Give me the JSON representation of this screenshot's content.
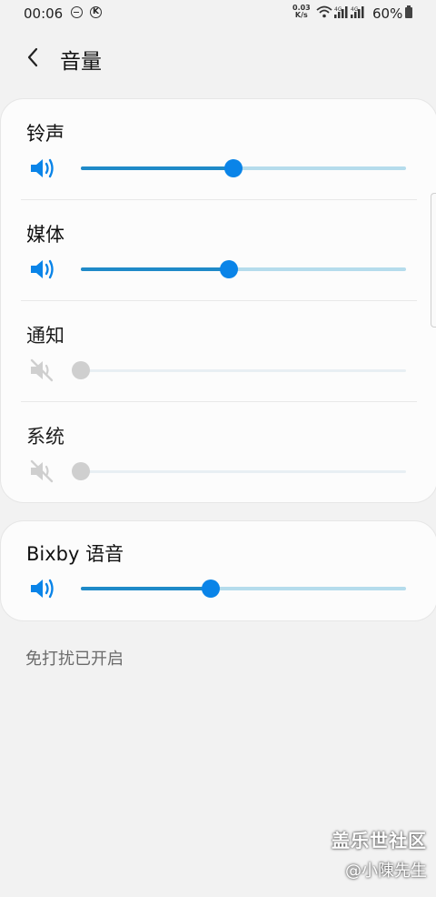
{
  "status_bar": {
    "time": "00:06",
    "net_speed_value": "0.03",
    "net_speed_unit": "K/s",
    "network_1": "4G",
    "network_2": "4G",
    "battery": "60%"
  },
  "header": {
    "title": "音量"
  },
  "volume_rows": [
    {
      "label": "铃声",
      "level": 0.47,
      "muted": false
    },
    {
      "label": "媒体",
      "level": 0.455,
      "muted": false
    },
    {
      "label": "通知",
      "level": 0.0,
      "muted": true
    },
    {
      "label": "系统",
      "level": 0.0,
      "muted": true
    }
  ],
  "bixby": {
    "label": "Bixby 语音",
    "level": 0.4,
    "muted": false
  },
  "dnd_note": "免打扰已开启",
  "watermark": {
    "line1": "盖乐世社区",
    "line2": "@小陳先生"
  },
  "colors": {
    "accent": "#0a84e8",
    "track_fill": "#1f8ac8",
    "track_bg": "#b5dcec",
    "muted": "#cfcfcf"
  }
}
